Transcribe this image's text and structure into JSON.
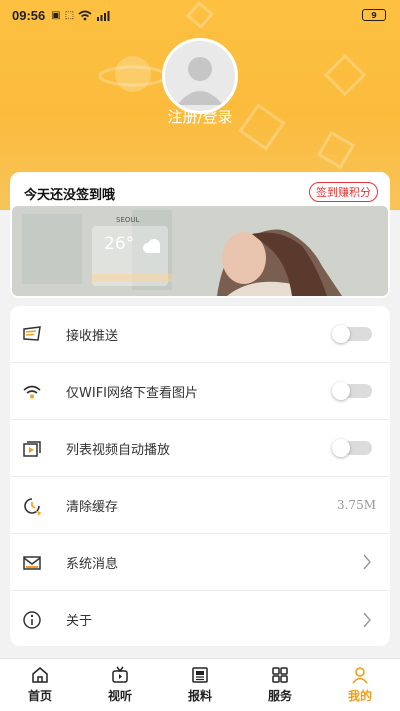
{
  "status_bar": {
    "time": "09:56",
    "battery": "9"
  },
  "profile": {
    "login_label": "注册/登录"
  },
  "signin": {
    "prompt": "今天还没签到哦",
    "button_label": "签到赚积分"
  },
  "banner": {
    "city": "SEOUL",
    "temperature": "26°"
  },
  "settings": [
    {
      "label": "接收推送",
      "control": "toggle",
      "on": false,
      "icon": "message-icon"
    },
    {
      "label": "仅WIFI网络下查看图片",
      "control": "toggle",
      "on": false,
      "icon": "wifi-icon"
    },
    {
      "label": "列表视频自动播放",
      "control": "toggle",
      "on": false,
      "icon": "video-play-icon"
    },
    {
      "label": "清除缓存",
      "control": "value",
      "value": "3.75M",
      "icon": "clock-clean-icon"
    },
    {
      "label": "系统消息",
      "control": "chevron",
      "icon": "mail-icon"
    },
    {
      "label": "关于",
      "control": "chevron",
      "icon": "info-icon"
    }
  ],
  "tabs": [
    {
      "label": "首页",
      "icon": "home-icon",
      "active": false
    },
    {
      "label": "视听",
      "icon": "tv-icon",
      "active": false
    },
    {
      "label": "报料",
      "icon": "news-icon",
      "active": false
    },
    {
      "label": "服务",
      "icon": "grid-icon",
      "active": false
    },
    {
      "label": "我的",
      "icon": "user-icon",
      "active": true
    }
  ],
  "colors": {
    "accent": "#f39c12",
    "header": "#fdc040",
    "signin_red": "#e33333"
  }
}
